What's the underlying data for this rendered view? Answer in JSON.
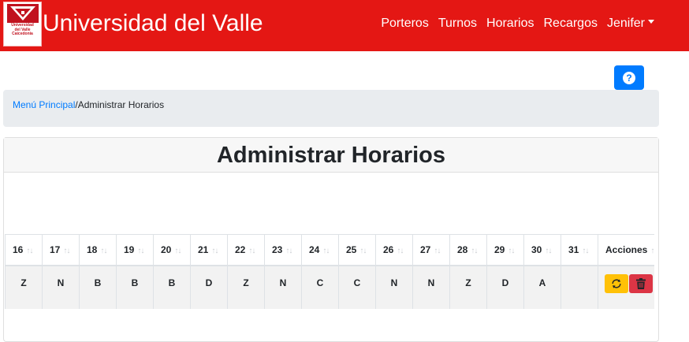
{
  "brand": {
    "logo_text_1": "Universidad",
    "logo_text_2": "del Valle",
    "logo_text_3": "Caicedonia",
    "title": "Universidad del Valle"
  },
  "nav": {
    "items": [
      "Porteros",
      "Turnos",
      "Horarios",
      "Recargos"
    ],
    "user": "Jenifer"
  },
  "help": {
    "label": "?"
  },
  "breadcrumb": {
    "home": "Menú Principal",
    "separator": "/",
    "current": "Administrar Horarios"
  },
  "page": {
    "title": "Administrar Horarios"
  },
  "table": {
    "headers": [
      "16",
      "17",
      "18",
      "19",
      "20",
      "21",
      "22",
      "23",
      "24",
      "25",
      "26",
      "27",
      "28",
      "29",
      "30",
      "31",
      "Acciones"
    ],
    "sort_icon": "↑↓",
    "rows": [
      {
        "cells": [
          "Z",
          "N",
          "B",
          "B",
          "B",
          "D",
          "Z",
          "N",
          "C",
          "C",
          "N",
          "N",
          "Z",
          "D",
          "A",
          ""
        ]
      }
    ]
  },
  "colors": {
    "navbar": "#e41714",
    "primary": "#007bff",
    "warning": "#ffc107",
    "danger": "#dc3545"
  },
  "icons": {
    "help": "question-circle-icon",
    "sync": "sync-icon",
    "delete": "trash-icon",
    "user_menu": "caret-down-icon"
  }
}
